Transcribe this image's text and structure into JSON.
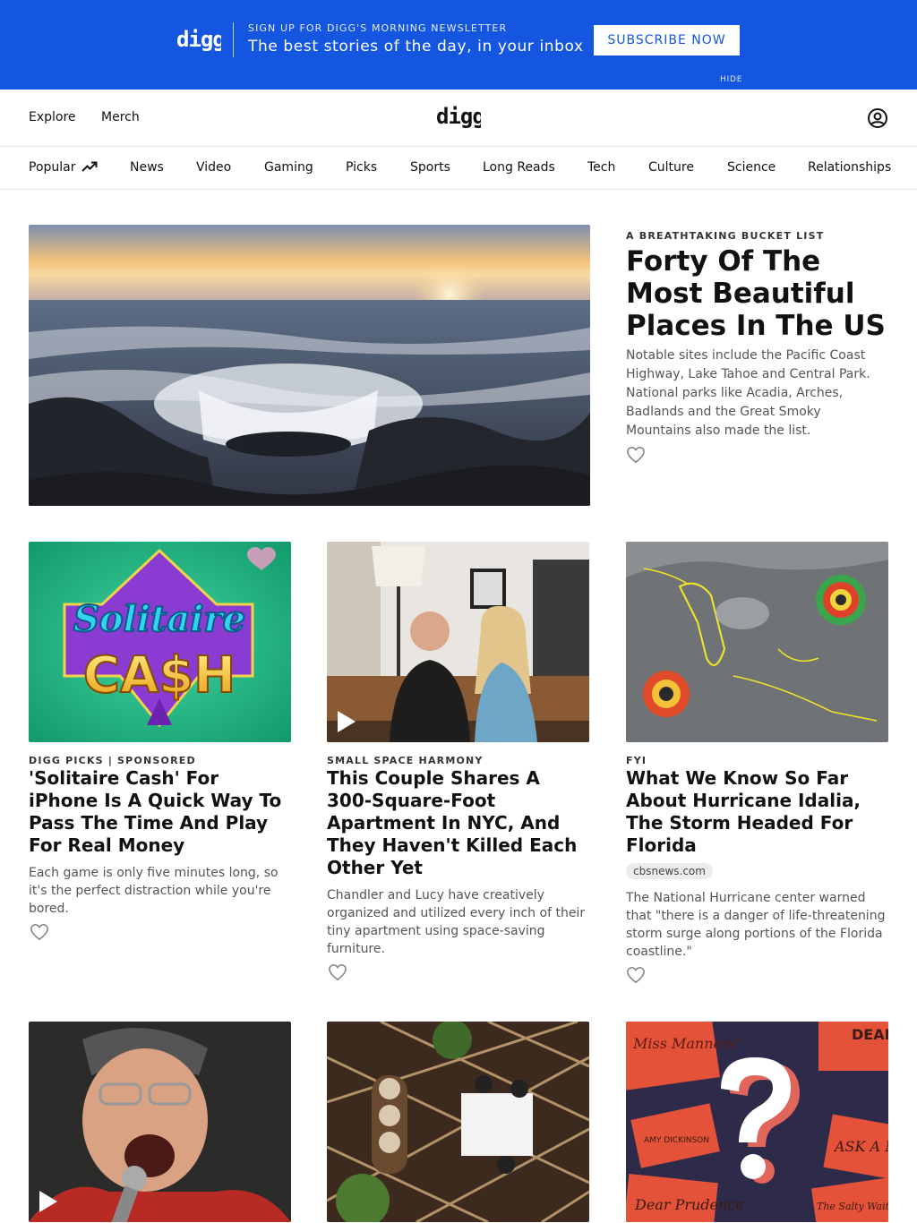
{
  "banner": {
    "logo": "digg",
    "kicker": "SIGN UP FOR DIGG'S MORNING NEWSLETTER",
    "tagline": "The best stories of the day, in your inbox",
    "subscribe_label": "SUBSCRIBE NOW",
    "hide_label": "HIDE",
    "background_color": "#1456e0"
  },
  "header": {
    "links": [
      "Explore",
      "Merch"
    ],
    "logo": "digg",
    "user_icon": "user-circle-icon"
  },
  "categories": [
    "Popular",
    "News",
    "Video",
    "Gaming",
    "Picks",
    "Sports",
    "Long Reads",
    "Tech",
    "Culture",
    "Science",
    "Relationships"
  ],
  "hero": {
    "kicker": "A BREATHTAKING BUCKET LIST",
    "title": "Forty Of The Most Beautiful Places In The US",
    "description": "Notable sites include the Pacific Coast Highway, Lake Tahoe and Central Park. National parks like Acadia, Arches, Badlands and the Great Smoky Mountains also made the list.",
    "image": "ocean-sunset-waterfall-image"
  },
  "cards": [
    {
      "kicker": "DIGG PICKS | SPONSORED",
      "title": "'Solitaire Cash' For iPhone Is A Quick Way To Pass The Time And Play For Real Money",
      "description": "Each game is only five minutes long, so it's the perfect distraction while you're bored.",
      "image": "solitaire-cash-logo-image",
      "image_text": [
        "Solitaire",
        "CA$H"
      ]
    },
    {
      "kicker": "SMALL SPACE HARMONY",
      "title": "This Couple Shares A 300-Square-Foot Apartment In NYC, And They Haven't Killed Each Other Yet",
      "description": "Chandler and Lucy have creatively organized and utilized every inch of their tiny apartment using space-saving furniture.",
      "image": "couple-on-couch-video-image"
    },
    {
      "kicker": "FYI",
      "title": "What We Know So Far About Hurricane Idalia, The Storm Headed For Florida",
      "source": "cbsnews.com",
      "description": "The National Hurricane center warned that \"there is a danger of life-threatening storm surge along portions of the Florida coastline.\"",
      "image": "hurricane-satellite-map-image"
    }
  ],
  "row3": [
    {
      "image": "man-singing-microphone-video-image"
    },
    {
      "image": "restaurant-overhead-image"
    },
    {
      "image": "question-mark-collage-image",
      "image_text": [
        "Miss Manners'",
        "DEAR ABBY",
        "AMY DICKINSON",
        "ASK A M",
        "Dear Prudence",
        "The Salty Waitress"
      ]
    }
  ]
}
